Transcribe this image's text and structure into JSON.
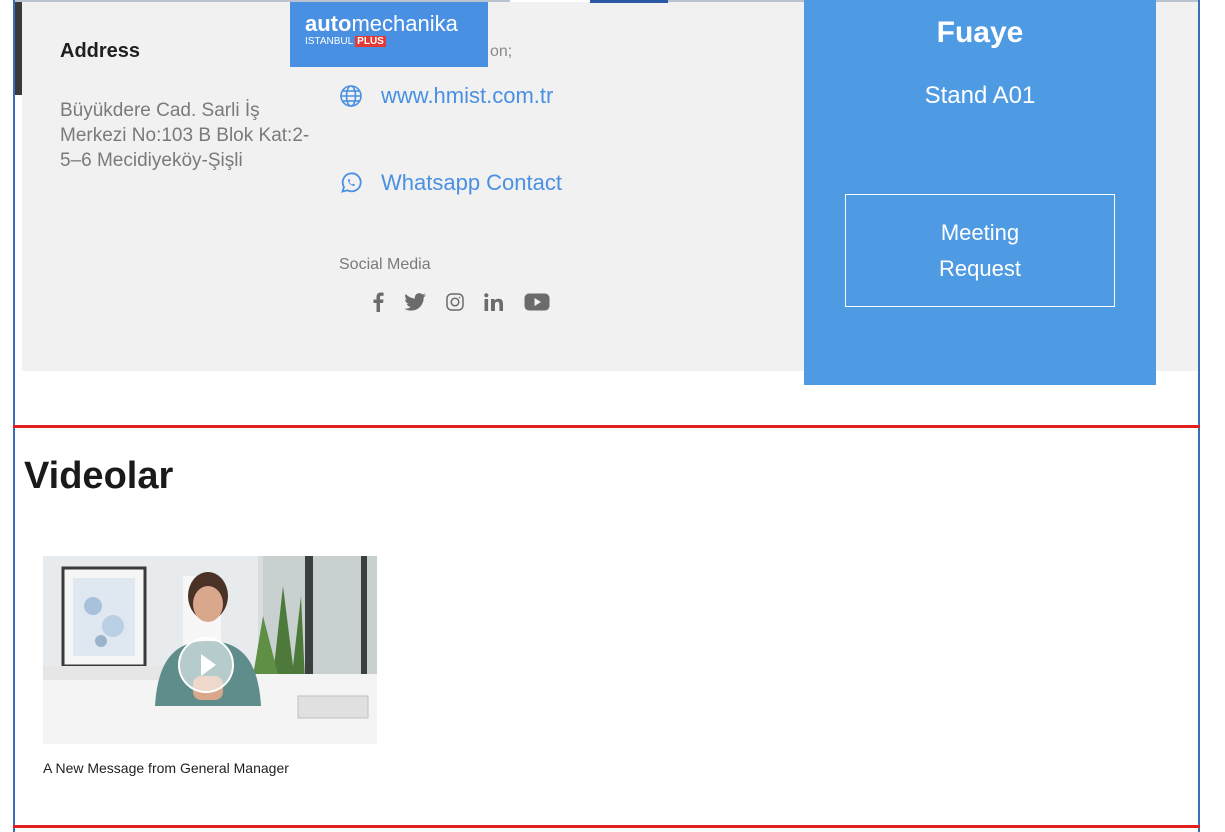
{
  "logo": {
    "main_bold": "auto",
    "main_light": "mechanika",
    "sub": "ISTANBUL",
    "plus": "PLUS"
  },
  "address": {
    "title": "Address",
    "text": "Büyükdere Cad. Sarli İş Merkezi No:103 B Blok Kat:2-5–6 Mecidiyeköy-Şişli"
  },
  "contact": {
    "partial_label": "on;",
    "website": "www.hmist.com.tr",
    "whatsapp": "Whatsapp Contact",
    "social_label": "Social Media",
    "social_icons": [
      "facebook-icon",
      "twitter-icon",
      "instagram-icon",
      "linkedin-icon",
      "youtube-icon"
    ]
  },
  "stand": {
    "title": "Fuaye",
    "subtitle": "Stand A01",
    "meeting_button": "Meeting Request"
  },
  "videos": {
    "title": "Videolar",
    "items": [
      {
        "caption": "A New Message from General Manager",
        "icon": "play-icon"
      }
    ]
  },
  "colors": {
    "accent_blue": "#4f9be3",
    "link_blue": "#4a90e2",
    "divider_red": "#e02020",
    "panel_gray": "#f1f1f1"
  }
}
